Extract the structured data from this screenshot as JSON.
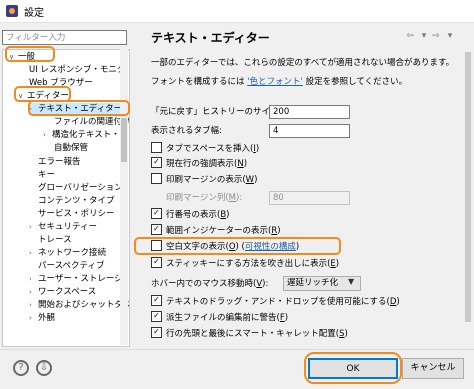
{
  "window": {
    "title": "設定"
  },
  "sidebar": {
    "filter_placeholder": "フィルター入力",
    "items": [
      {
        "label": "一般",
        "arrow": "∨"
      },
      {
        "label": "UI レスポンシブ・モニタ",
        "arrow": ""
      },
      {
        "label": "Web ブラウザー",
        "arrow": ""
      },
      {
        "label": "エディター",
        "arrow": "∨"
      },
      {
        "label": "テキスト・エディター",
        "arrow": "›"
      },
      {
        "label": "ファイルの関連付け",
        "arrow": ""
      },
      {
        "label": "構造化テキスト・エ",
        "arrow": "›"
      },
      {
        "label": "自動保管",
        "arrow": ""
      },
      {
        "label": "エラー報告",
        "arrow": ""
      },
      {
        "label": "キー",
        "arrow": ""
      },
      {
        "label": "グローバリゼーション",
        "arrow": ""
      },
      {
        "label": "コンテンツ・タイプ",
        "arrow": ""
      },
      {
        "label": "サービス・ポリシー",
        "arrow": ""
      },
      {
        "label": "セキュリティー",
        "arrow": "›"
      },
      {
        "label": "トレース",
        "arrow": ""
      },
      {
        "label": "ネットワーク接続",
        "arrow": "›"
      },
      {
        "label": "パースペクティブ",
        "arrow": ""
      },
      {
        "label": "ユーザー・ストレージ・サ",
        "arrow": "›"
      },
      {
        "label": "ワークスペース",
        "arrow": "›"
      },
      {
        "label": "開始およびシャットダウ",
        "arrow": "›"
      },
      {
        "label": "外観",
        "arrow": "›"
      }
    ]
  },
  "main": {
    "title": "テキスト・エディター",
    "nav_back": "⇦",
    "nav_forward": "⇨",
    "nav_menu": "▾",
    "description": "一部のエディターでは、これらの設定のすべてが適用されない場合があります。",
    "font_text_before": "フォントを構成するには",
    "font_link": "'色とフォント'",
    "font_text_after": "設定を参照してください。",
    "undo_history_label": "「元に戻す」ヒストリーのサイズ(",
    "undo_history_mnemonic": "U",
    "undo_history_value": "200",
    "tab_width_label": "表示されるタブ幅:",
    "tab_width_value": "4",
    "insert_spaces_label": "タブでスペースを挿入(",
    "insert_spaces_mnemonic": "I",
    "highlight_line_label": "現在行の強調表示(",
    "highlight_line_mnemonic": "N",
    "print_margin_label": "印刷マージンの表示(",
    "print_margin_mnemonic": "W",
    "print_margin_column_label": "印刷マージン列(",
    "print_margin_column_mnemonic": "M",
    "print_margin_column_value": "80",
    "line_numbers_label": "行番号の表示(",
    "line_numbers_mnemonic": "B",
    "range_indicator_label": "範囲インジケーターの表示(",
    "range_indicator_mnemonic": "R",
    "whitespace_label": "空白文字の表示(",
    "whitespace_mnemonic": "O",
    "whitespace_link": "可視性の構成",
    "sticky_label": "スティッキーにする方法を吹き出しに表示(",
    "sticky_mnemonic": "E",
    "hover_label": "ホバー内でのマウス移動時(",
    "hover_mnemonic": "V",
    "hover_value": "遅延リッチ化",
    "drag_drop_label": "テキストのドラッグ・アンド・ドロップを使用可能にする(",
    "drag_drop_mnemonic": "D",
    "derived_warn_label": "派生ファイルの編集前に警告(",
    "derived_warn_mnemonic": "F",
    "smart_caret_label": "行の先頭と最後にスマート・キャレット配置(",
    "smart_caret_mnemonic": "S"
  },
  "footer": {
    "help_icon": "?",
    "import_icon": "⇩",
    "ok_label": "OK",
    "cancel_label": "キャンセル"
  },
  "colors": {
    "highlight_orange": "#f28a1c",
    "link_blue": "#1b5fae",
    "selection": "#cce8ff",
    "ok_border": "#0078d7"
  }
}
